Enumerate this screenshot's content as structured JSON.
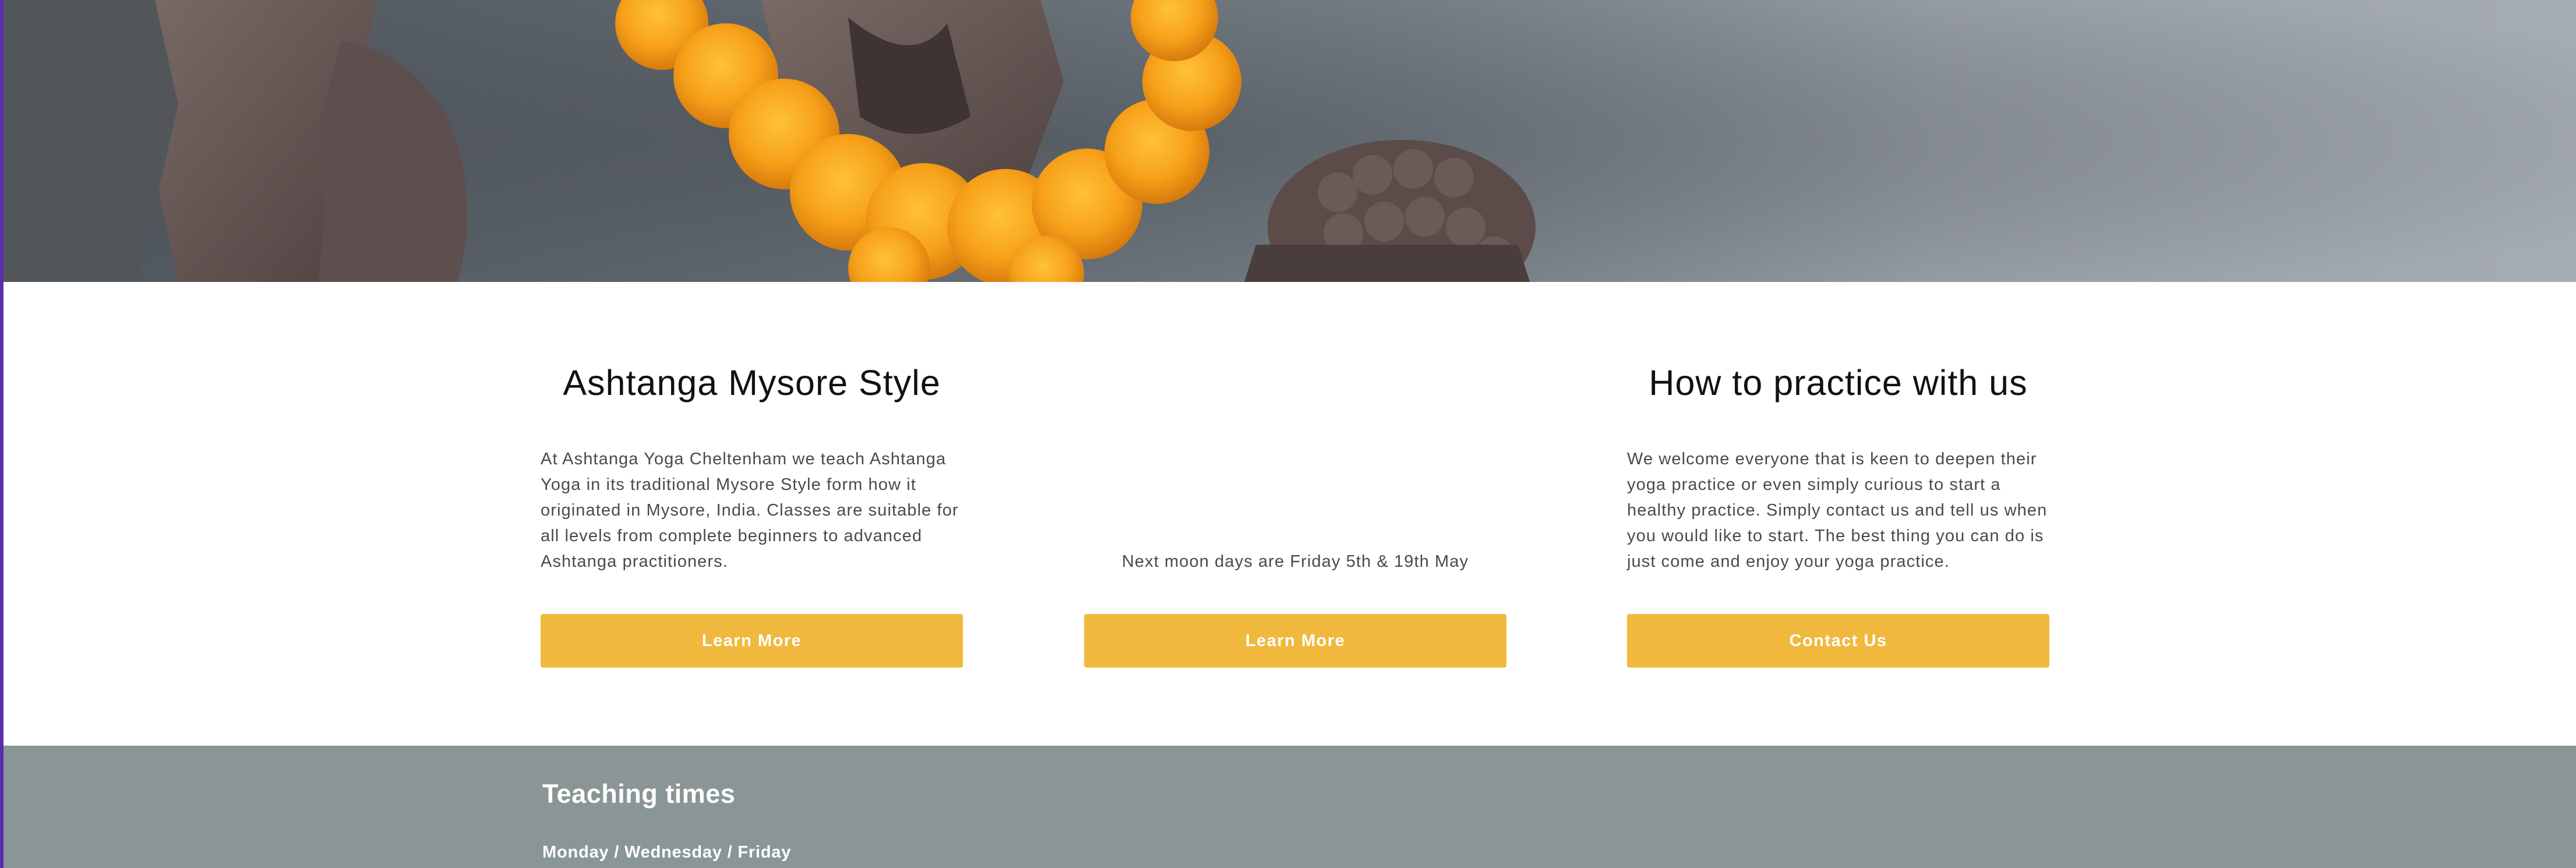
{
  "hero": {
    "image_label": "Stone statue hands with orange marigold garland"
  },
  "columns": [
    {
      "title": "Ashtanga Mysore Style",
      "text": "At Ashtanga Yoga Cheltenham we teach Ashtanga Yoga in its traditional Mysore Style form how it originated in Mysore, India. Classes are suitable for all levels from complete beginners to advanced Ashtanga practitioners.",
      "button_label": "Learn More"
    },
    {
      "title": "",
      "text": "Next moon days are Friday 5th & 19th May",
      "button_label": "Learn More"
    },
    {
      "title": "How to practice with us",
      "text": "We welcome everyone that is keen to deepen their yoga practice or even simply curious to start a healthy practice. Simply contact us and tell us when you would like to start. The best thing you can do is just come and enjoy your yoga practice.",
      "button_label": "Contact Us"
    }
  ],
  "teaching": {
    "title": "Teaching times",
    "days": "Monday / Wednesday / Friday"
  },
  "colors": {
    "accent": "#f0b93e",
    "band": "#8a9695",
    "edge": "#5a2db0"
  }
}
